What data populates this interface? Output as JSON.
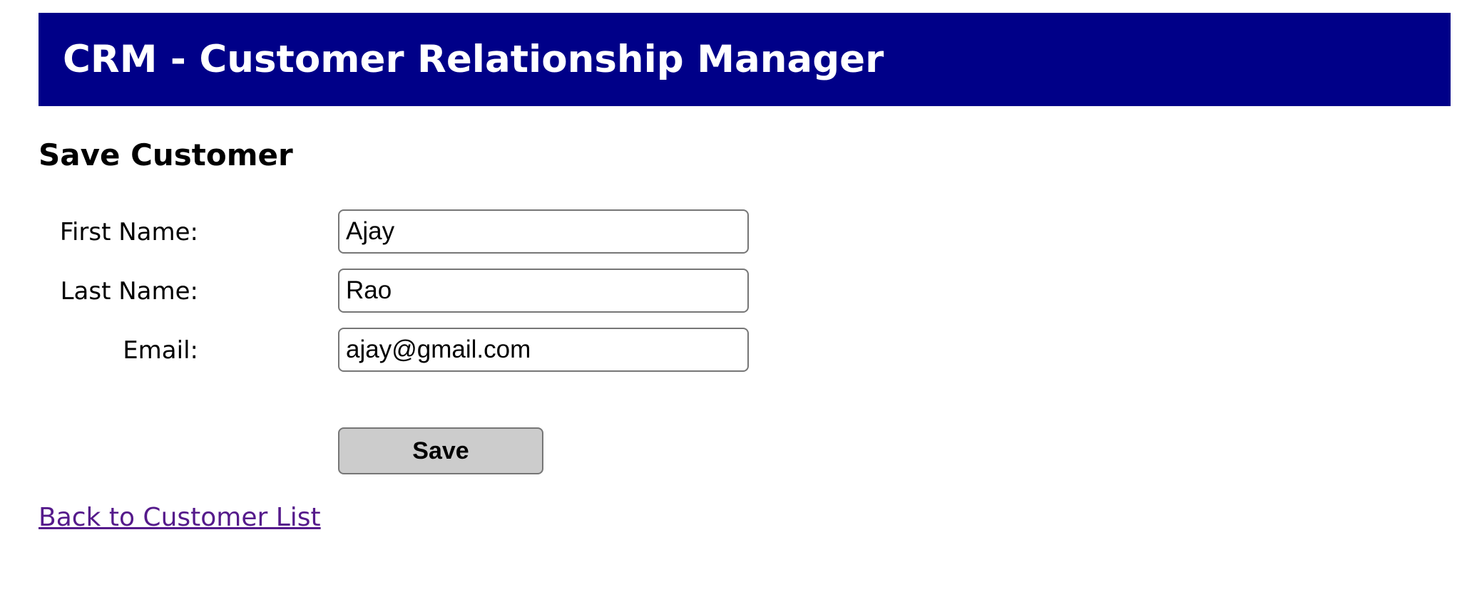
{
  "header": {
    "title": "CRM - Customer Relationship Manager",
    "background_color": "#000088",
    "text_color": "#ffffff"
  },
  "page": {
    "title": "Save Customer"
  },
  "form": {
    "first_name": {
      "label": "First Name:",
      "value": "Ajay"
    },
    "last_name": {
      "label": "Last Name:",
      "value": "Rao"
    },
    "email": {
      "label": "Email:",
      "value": "ajay@gmail.com"
    },
    "save_label": "Save",
    "save_button_color": "#cccccc"
  },
  "back_link": {
    "label": "Back to Customer List",
    "color": "#551a8b"
  }
}
